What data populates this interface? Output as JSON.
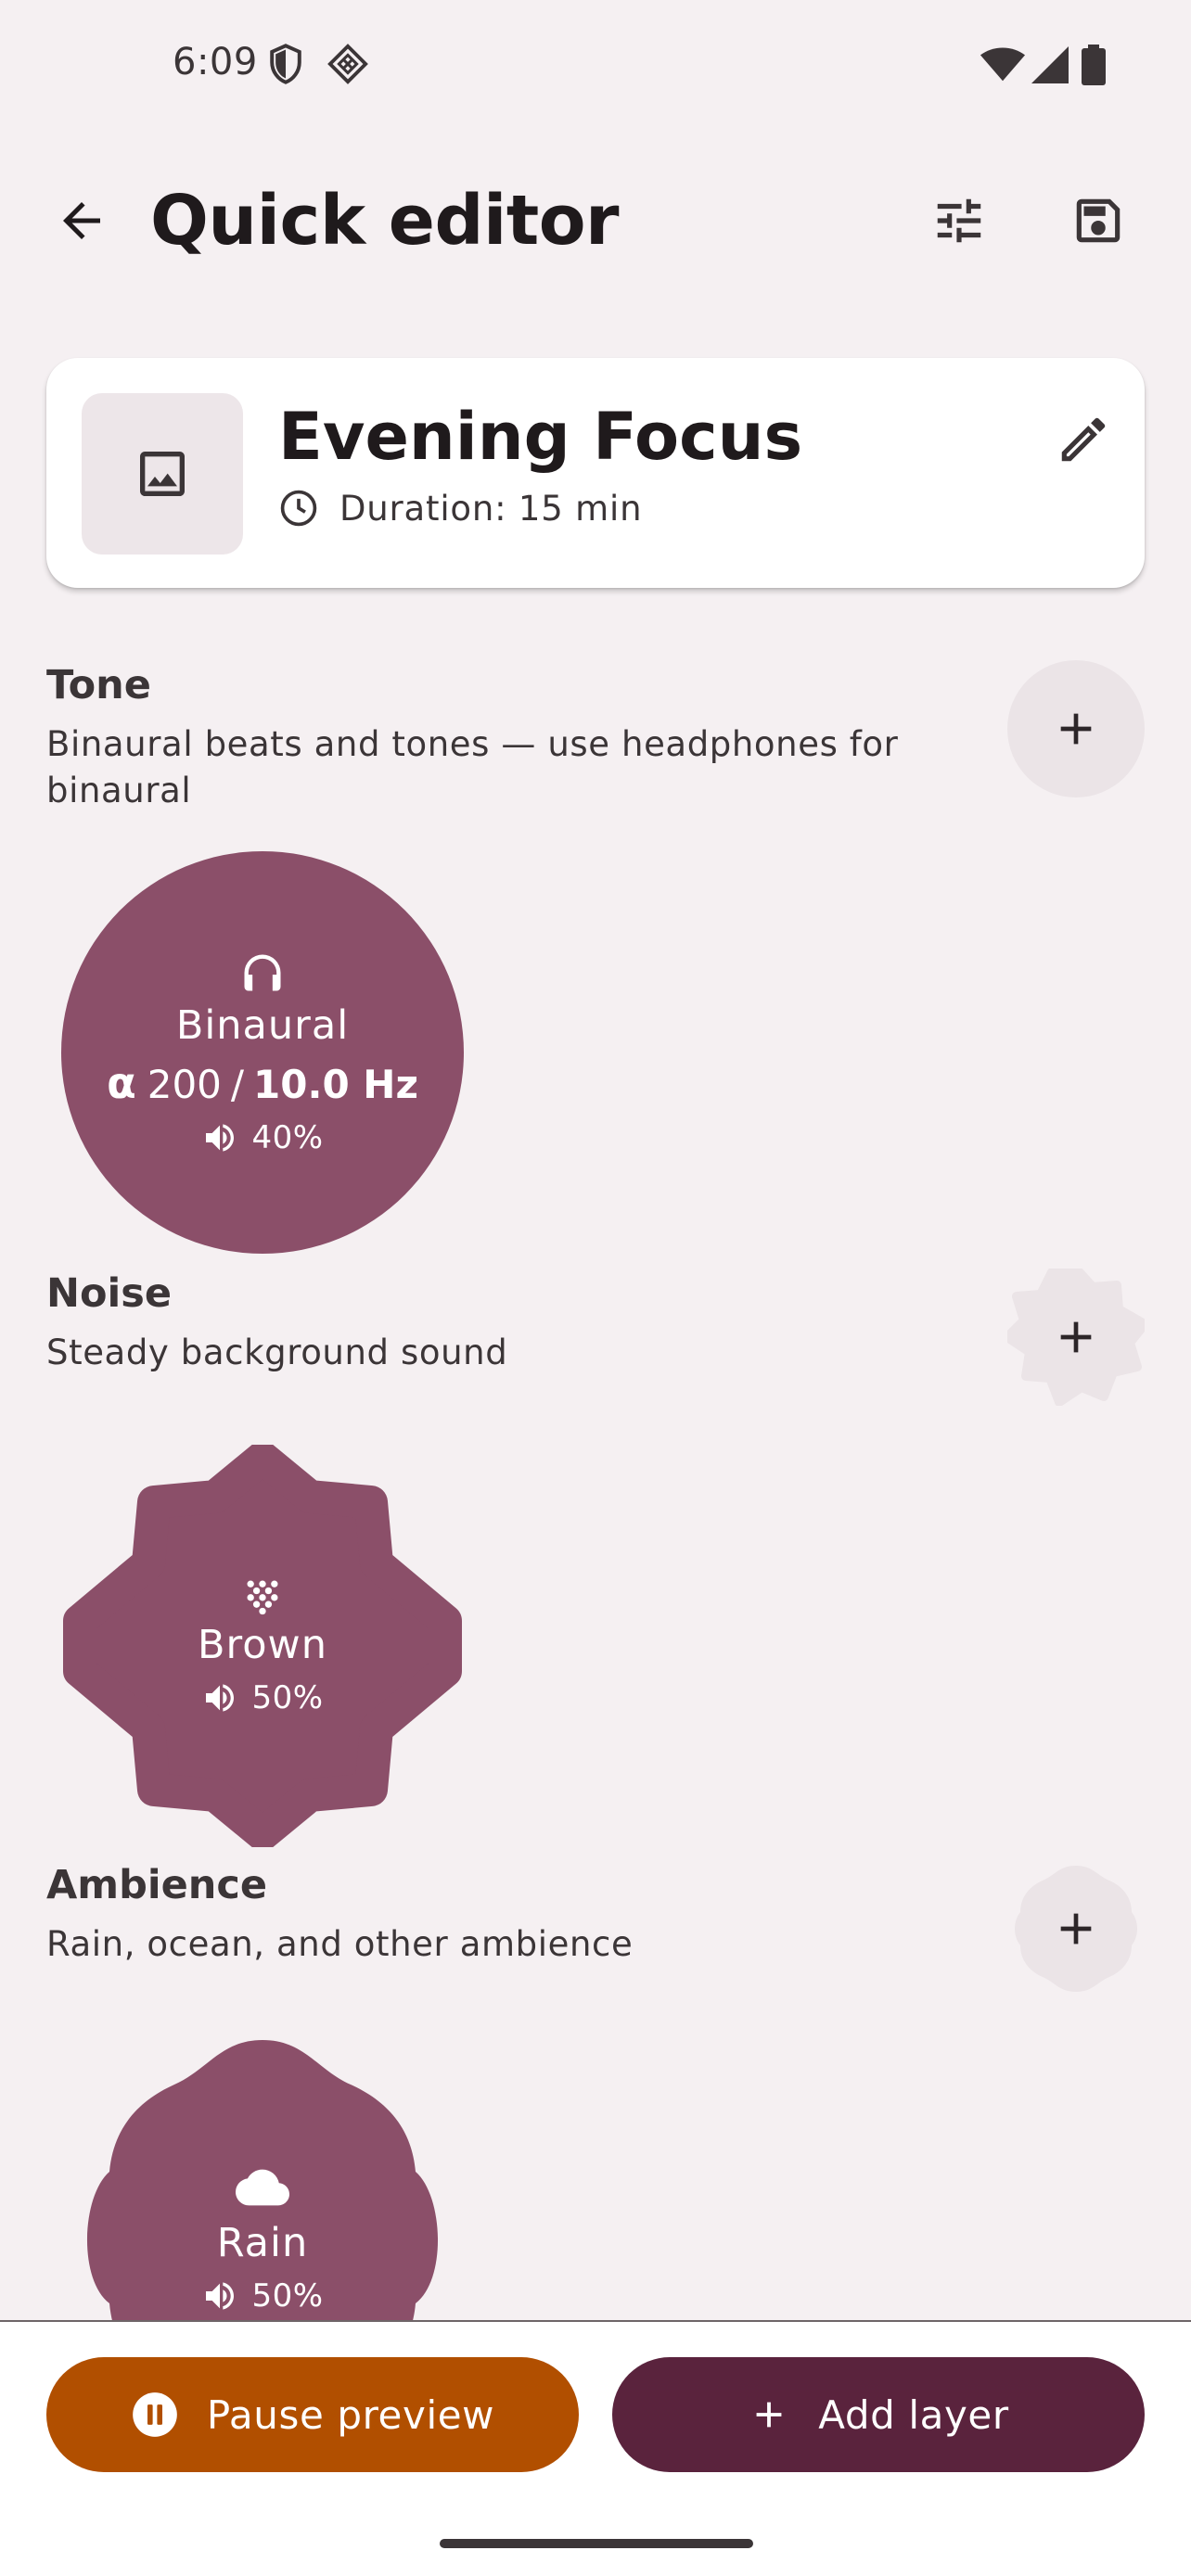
{
  "status_bar": {
    "time": "6:09",
    "icons": [
      "shield-icon",
      "diamond-grid-icon",
      "wifi-icon",
      "signal-icon",
      "battery-icon"
    ]
  },
  "app_bar": {
    "title": "Quick editor",
    "icons": [
      "arrow-back-icon",
      "tune-icon",
      "save-icon"
    ]
  },
  "header": {
    "title": "Evening Focus",
    "duration": "Duration: 15 min",
    "icons": [
      "image-icon",
      "clock-icon",
      "edit-icon"
    ]
  },
  "sections": {
    "tone": {
      "title": "Tone",
      "description": "Binaural beats and tones — use headphones for binaural",
      "layer": {
        "icon": "headphones-icon",
        "name": "Binaural",
        "greek": "α",
        "carrier": "200",
        "separator": "/",
        "beat": "10.0 Hz",
        "volume": "40%"
      }
    },
    "noise": {
      "title": "Noise",
      "description": "Steady background sound",
      "layer": {
        "icon": "grain-icon",
        "name": "Brown",
        "volume": "50%"
      }
    },
    "ambience": {
      "title": "Ambience",
      "description": "Rain, ocean, and other ambience",
      "layer": {
        "icon": "cloud-icon",
        "name": "Rain",
        "volume": "50%"
      }
    }
  },
  "bottom_bar": {
    "pause_label": "Pause preview",
    "add_layer_label": "Add layer"
  },
  "colors": {
    "background": "#f5f0f2",
    "layer_fill": "#8b4f69",
    "add_button_fill": "#ebe4e7",
    "pause_button": "#b14f00",
    "add_layer_button": "#5a233d"
  }
}
